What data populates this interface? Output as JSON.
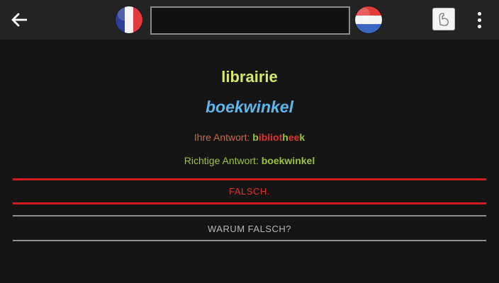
{
  "toolbar": {
    "search_value": "",
    "source_language_flag": "france-flag-icon",
    "target_language_flag": "netherlands-flag-icon"
  },
  "quiz": {
    "question_word": "librairie",
    "correct_word": "boekwinkel",
    "your_answer_label": "Ihre Antwort:",
    "your_answer_segments": [
      {
        "text": "b",
        "status": "correct"
      },
      {
        "text": "ibliot",
        "status": "wrong"
      },
      {
        "text": "h",
        "status": "correct"
      },
      {
        "text": "ee",
        "status": "wrong"
      },
      {
        "text": "k",
        "status": "correct"
      }
    ],
    "correct_answer_label": "Richtige Antwort:",
    "correct_answer_value": "boekwinkel",
    "verdict": "FALSCH.",
    "why_button": "WARUM FALSCH?"
  },
  "colors": {
    "question": "#d7e86d",
    "answer": "#5fb6ea",
    "wrong": "#e0322c",
    "correct": "#9cc43a"
  }
}
